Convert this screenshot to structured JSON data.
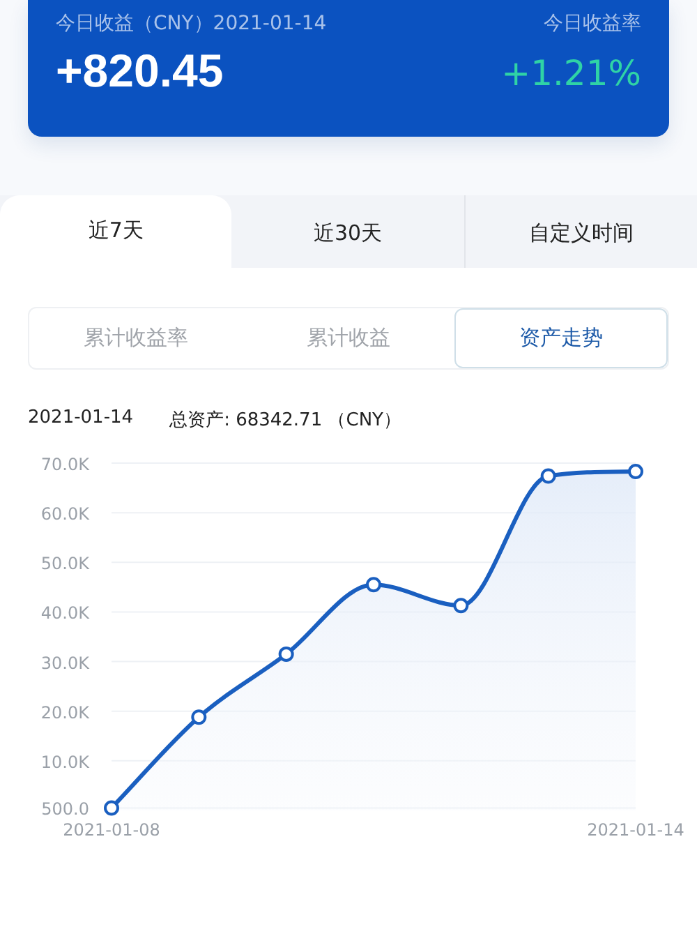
{
  "summary": {
    "label": "今日收益（CNY）2021-01-14",
    "amount": "+820.45",
    "rate_label": "今日收益率",
    "rate": "+1.21%"
  },
  "period_tabs": [
    {
      "label": "近7天",
      "selected": true
    },
    {
      "label": "近30天",
      "selected": false
    },
    {
      "label": "自定义时间",
      "selected": false
    }
  ],
  "metric_tabs": [
    {
      "label": "累计收益率",
      "selected": false
    },
    {
      "label": "累计收益",
      "selected": false
    },
    {
      "label": "资产走势",
      "selected": true
    }
  ],
  "info": {
    "date": "2021-01-14",
    "total": "总资产: 68342.71 （CNY）"
  },
  "chart": {
    "chart_data": {
      "type": "area",
      "grid": true,
      "categories": [
        "2021-01-08",
        null,
        null,
        null,
        null,
        null,
        "2021-01-14"
      ],
      "series": [
        {
          "color": "#1a5fc0",
          "values": [
            500,
            18800,
            31500,
            45500,
            41300,
            67400,
            68300
          ]
        }
      ],
      "ylim": [
        0,
        70000
      ],
      "yticks": [
        {
          "value": 500,
          "label": "500.0"
        },
        {
          "value": 10000,
          "label": "10.0K"
        },
        {
          "value": 20000,
          "label": "20.0K"
        },
        {
          "value": 30000,
          "label": "30.0K"
        },
        {
          "value": 40000,
          "label": "40.0K"
        },
        {
          "value": 50000,
          "label": "50.0K"
        },
        {
          "value": 60000,
          "label": "60.0K"
        },
        {
          "value": 70000,
          "label": "70.0K"
        }
      ]
    }
  }
}
